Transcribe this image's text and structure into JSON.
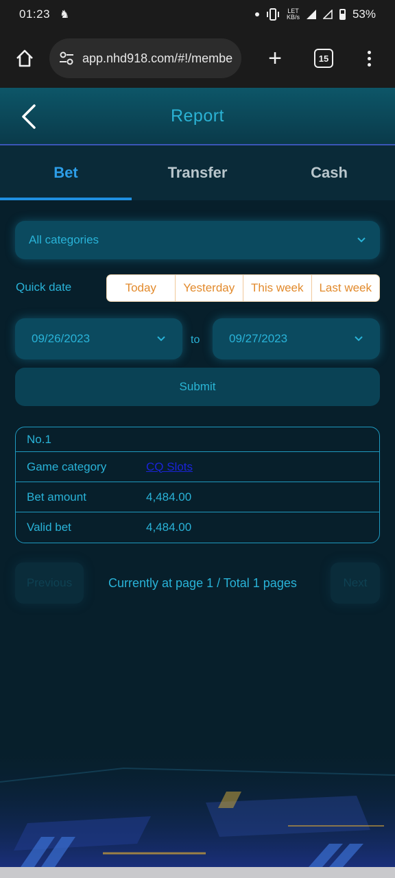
{
  "status_bar": {
    "time": "01:23",
    "network_top": "LET",
    "network_bottom": "KB/s",
    "battery": "53%"
  },
  "browser": {
    "url": "app.nhd918.com/#!/member",
    "tab_count": "15"
  },
  "header": {
    "title": "Report"
  },
  "tabs": [
    {
      "label": "Bet",
      "active": true
    },
    {
      "label": "Transfer",
      "active": false
    },
    {
      "label": "Cash",
      "active": false
    }
  ],
  "filters": {
    "category": "All categories",
    "quick_date_label": "Quick date",
    "quick_dates": [
      "Today",
      "Yesterday",
      "This week",
      "Last week"
    ],
    "date_from": "09/26/2023",
    "to_label": "to",
    "date_to": "09/27/2023",
    "submit": "Submit"
  },
  "record": {
    "number": "No.1",
    "rows": [
      {
        "key": "Game category",
        "value": "CQ Slots"
      },
      {
        "key": "Bet amount",
        "value": "4,484.00"
      },
      {
        "key": "Valid bet",
        "value": "4,484.00"
      }
    ]
  },
  "pagination": {
    "previous": "Previous",
    "info": "Currently at page 1 / Total 1 pages",
    "next": "Next"
  },
  "colors": {
    "background": "#071f2b",
    "accent": "#29b3d8",
    "quick_date_text": "#e28a2c",
    "active_tab": "#2d9ee8"
  }
}
